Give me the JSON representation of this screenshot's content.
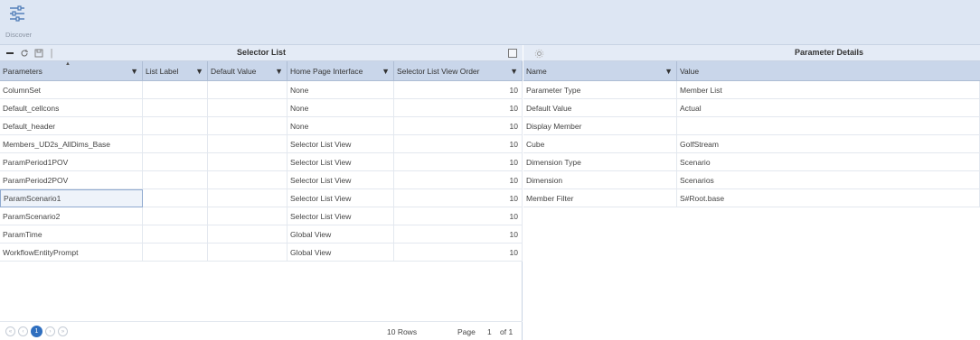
{
  "ribbon": {
    "discover_label": "Discover"
  },
  "selector": {
    "title": "Selector List",
    "columns": [
      "Parameters",
      "List Label",
      "Default Value",
      "Home Page Interface",
      "Selector List View Order"
    ],
    "rows": [
      {
        "name": "ColumnSet",
        "label": "",
        "default": "",
        "interface": "None",
        "order": "10"
      },
      {
        "name": "Default_cellcons",
        "label": "",
        "default": "",
        "interface": "None",
        "order": "10"
      },
      {
        "name": "Default_header",
        "label": "",
        "default": "",
        "interface": "None",
        "order": "10"
      },
      {
        "name": "Members_UD2s_AllDims_Base",
        "label": "",
        "default": "",
        "interface": "Selector List View",
        "order": "10"
      },
      {
        "name": "ParamPeriod1POV",
        "label": "",
        "default": "",
        "interface": "Selector List View",
        "order": "10"
      },
      {
        "name": "ParamPeriod2POV",
        "label": "",
        "default": "",
        "interface": "Selector List View",
        "order": "10"
      },
      {
        "name": "ParamScenario1",
        "label": "",
        "default": "",
        "interface": "Selector List View",
        "order": "10"
      },
      {
        "name": "ParamScenario2",
        "label": "",
        "default": "",
        "interface": "Selector List View",
        "order": "10"
      },
      {
        "name": "ParamTime",
        "label": "",
        "default": "",
        "interface": "Global View",
        "order": "10"
      },
      {
        "name": "WorkflowEntityPrompt",
        "label": "",
        "default": "",
        "interface": "Global View",
        "order": "10"
      }
    ],
    "selected_row": 6,
    "pager": {
      "current_page": "1",
      "rows_text": "10 Rows",
      "page_label": "Page",
      "page_num": "1",
      "of_text": "of 1"
    }
  },
  "details": {
    "title": "Parameter Details",
    "columns": [
      "Name",
      "Value"
    ],
    "rows": [
      {
        "name": "Parameter Type",
        "value": "Member List"
      },
      {
        "name": "Default Value",
        "value": "Actual"
      },
      {
        "name": "Display Member",
        "value": ""
      },
      {
        "name": "Cube",
        "value": "GolfStream"
      },
      {
        "name": "Dimension Type",
        "value": "Scenario"
      },
      {
        "name": "Dimension",
        "value": "Scenarios"
      },
      {
        "name": "Member Filter",
        "value": "S#Root.base"
      }
    ]
  },
  "colors": {
    "ribbon_bg": "#dde6f3",
    "header_bg": "#c9d6ea",
    "accent": "#2f6fbf"
  }
}
